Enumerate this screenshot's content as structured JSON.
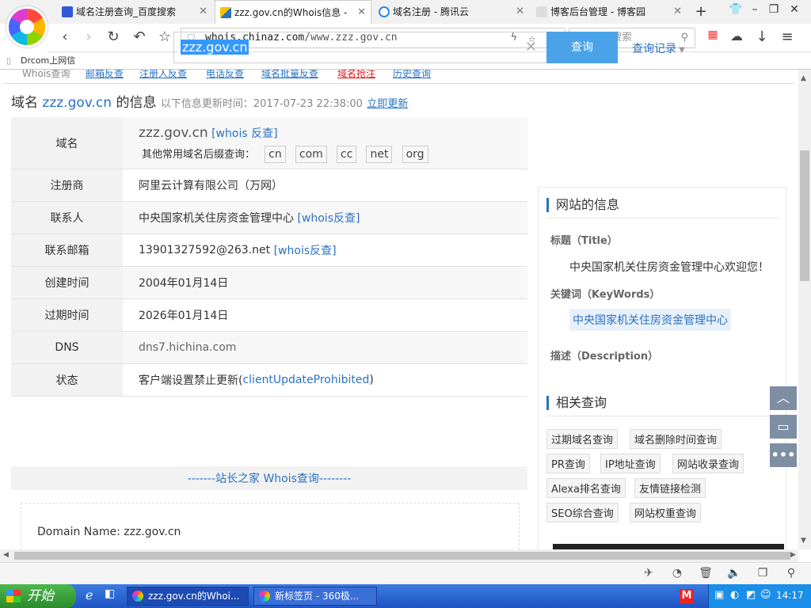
{
  "browser": {
    "tabs": [
      {
        "title": "域名注册查询_百度搜索",
        "active": false
      },
      {
        "title": "zzz.gov.cn的Whois信息 -",
        "active": true
      },
      {
        "title": "域名注册 - 腾讯云",
        "active": false
      },
      {
        "title": "博客后台管理 - 博客园",
        "active": false
      }
    ],
    "url_host": "whois.chinaz.com",
    "url_path": "/www.zzz.gov.cn",
    "search_placeholder": "360搜索",
    "bookmark": "Drcom上网信"
  },
  "subnav": [
    "Whois查询",
    "邮箱反查",
    "注册人反查",
    "电话反查",
    "域名批量反查",
    "域名抢注",
    "历史查询"
  ],
  "search": {
    "value": "zzz.gov.cn",
    "button": "查询",
    "history": "查询记录"
  },
  "heading": {
    "prefix": "域名",
    "domain": "zzz.gov.cn",
    "suffix": "的信息",
    "update_label": "以下信息更新时间：2017-07-23 22:38:00",
    "update_link": "立即更新"
  },
  "info": {
    "domain_label": "域名",
    "domain_value": "zzz.gov.cn",
    "domain_link": "[whois 反查]",
    "tld_label": "其他常用域名后缀查询：",
    "tlds": [
      "cn",
      "com",
      "cc",
      "net",
      "org"
    ],
    "registrar_label": "注册商",
    "registrar": "阿里云计算有限公司（万网）",
    "contact_label": "联系人",
    "contact": "中央国家机关住房资金管理中心",
    "contact_link": "[whois反查]",
    "email_label": "联系邮箱",
    "email": "13901327592@263.net",
    "email_link": "[whois反查]",
    "created_label": "创建时间",
    "created": "2004年01月14日",
    "expire_label": "过期时间",
    "expire": "2026年01月14日",
    "dns_label": "DNS",
    "dns": "dns7.hichina.com",
    "status_label": "状态",
    "status_text": "客户端设置禁止更新(",
    "status_code": "clientUpdateProhibited",
    "status_close": ")",
    "whois_bar": "-------站长之家 Whois查询--------",
    "raw_first": "Domain Name: zzz.gov.cn"
  },
  "sidebar": {
    "site_title": "网站的信息",
    "title_label": "标题（Title）",
    "title_value": "中央国家机关住房资金管理中心欢迎您！",
    "keywords_label": "关键词（KeyWords）",
    "keywords_value": "中央国家机关住房资金管理中心",
    "desc_label": "描述（Description）",
    "related_title": "相关查询",
    "related": [
      "过期域名查询",
      "域名删除时间查询",
      "PR查询",
      "IP地址查询",
      "网站收录查询",
      "Alexa排名查询",
      "友情链接检测",
      "SEO综合查询",
      "网站权重查询"
    ]
  },
  "taskbar": {
    "start": "开始",
    "tasks": [
      "zzz.gov.cn的Whoi...",
      "新标签页 - 360极..."
    ],
    "clock": "14:17"
  }
}
